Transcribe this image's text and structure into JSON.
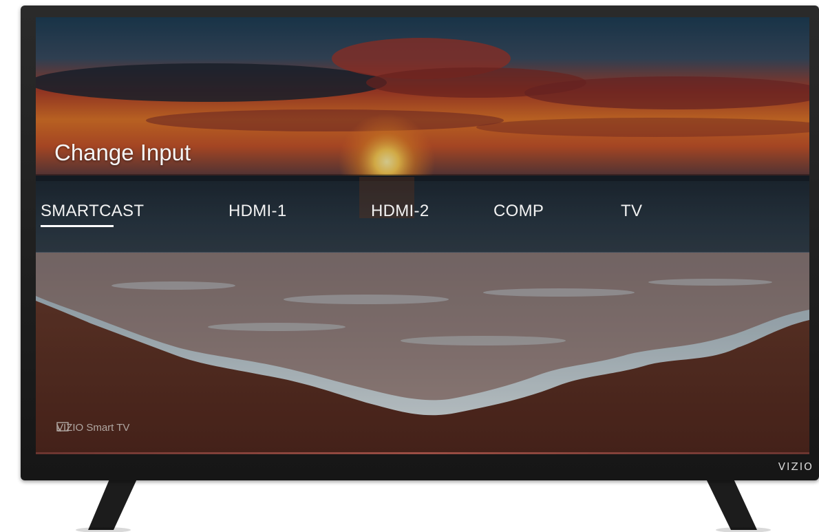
{
  "screen": {
    "title": "Change Input",
    "inputs": [
      {
        "label": "SMARTCAST",
        "selected": true
      },
      {
        "label": "HDMI-1",
        "selected": false
      },
      {
        "label": "HDMI-2",
        "selected": false
      },
      {
        "label": "COMP",
        "selected": false
      },
      {
        "label": "TV",
        "selected": false
      }
    ],
    "footer_brand": "VIZIO Smart TV"
  },
  "tv": {
    "brand": "VIZIO"
  },
  "icons": [
    "cast-icon"
  ]
}
